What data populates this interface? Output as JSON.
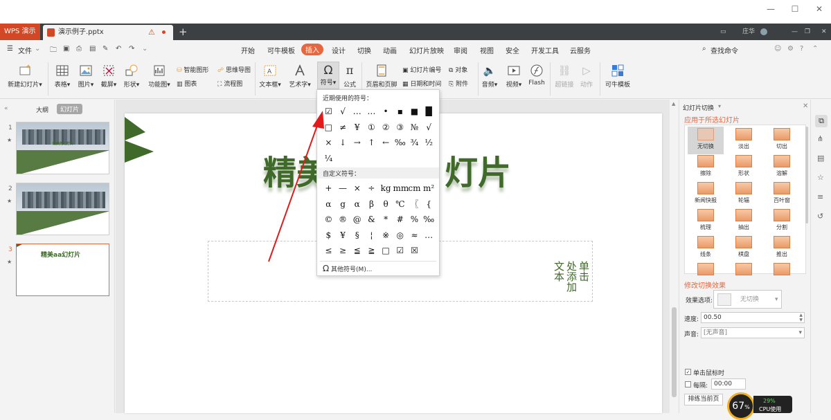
{
  "tabs": {
    "app_label": "WPS 演示",
    "doc_label": "演示例子.pptx",
    "add_label": "+",
    "user_name": "庄华"
  },
  "menu": {
    "file": "文件",
    "items": [
      "开始",
      "可牛模板",
      "插入",
      "设计",
      "切换",
      "动画",
      "幻灯片放映",
      "审阅",
      "视图",
      "安全",
      "开发工具",
      "云服务"
    ],
    "search": "查找命令"
  },
  "ribbon": {
    "new_slide": "新建幻灯片",
    "table": "表格",
    "picture": "图片",
    "screenshot": "截屏",
    "shape": "形状",
    "function_chart": "功能图",
    "smart_shape": "智能图形",
    "chart": "图表",
    "mind_map": "思维导图",
    "flowchart": "流程图",
    "textbox": "文本框",
    "art_text": "艺术字",
    "symbol": "符号",
    "formula": "公式",
    "header_footer": "页眉和页脚",
    "slide_number": "幻灯片编号",
    "object": "对象",
    "date_time": "日期和时间",
    "attachment": "附件",
    "audio": "音频",
    "video": "视频",
    "flash": "Flash",
    "hyperlink": "超链接",
    "action": "动作",
    "kaniu_template": "可牛模板"
  },
  "leftpanel": {
    "outline_tab": "大纲",
    "slides_tab": "幻灯片",
    "thumbs": [
      {
        "num": "1",
        "caption": "精美的幻灯片"
      },
      {
        "num": "2",
        "caption": ""
      },
      {
        "num": "3",
        "caption": "精美aa幻灯片"
      }
    ]
  },
  "slide": {
    "title_visible_left": "精美",
    "title_visible_right": "灯片",
    "vertical_text_cols": [
      "单击",
      "处添加",
      "文本"
    ]
  },
  "symbols": {
    "recent_label": "近期使用的符号：",
    "recent": [
      [
        "☑",
        "√",
        "…",
        "…",
        "•",
        "▪",
        "■",
        "█"
      ],
      [
        "□",
        "≠",
        "¥",
        "①",
        "②",
        "③",
        "№",
        "√"
      ],
      [
        "×",
        "↓",
        "→",
        "↑",
        "←",
        "‰",
        "¾",
        "½"
      ],
      [
        "¼"
      ]
    ],
    "custom_label": "自定义符号：",
    "custom": [
      [
        "+",
        "—",
        "×",
        "÷",
        "kg",
        "mm",
        "cm",
        "m²"
      ],
      [
        "α",
        "g",
        "α",
        "β",
        "θ",
        "℃",
        "〖",
        "{"
      ],
      [
        "©",
        "®",
        "@",
        "&",
        "*",
        "#",
        "%",
        "‰"
      ],
      [
        "$",
        "¥",
        "§",
        "¦",
        "※",
        "◎",
        "≈",
        "…"
      ],
      [
        "≤",
        "≥",
        "≦",
        "≧",
        "□",
        "☑",
        "☒"
      ]
    ],
    "more": "其他符号(M)..."
  },
  "rightpanel": {
    "title": "幻灯片切换",
    "apply_label": "应用于所选幻灯片",
    "transitions": [
      "无切换",
      "淡出",
      "切出",
      "擦除",
      "形状",
      "溶解",
      "新闻快报",
      "轮辐",
      "百叶窗",
      "梳理",
      "抽出",
      "分割",
      "线条",
      "棋盘",
      "推出",
      "",
      "",
      ""
    ],
    "modify_label": "修改切换效果",
    "effect_label": "效果选项:",
    "effect_value": "无切换",
    "speed_label": "速度:",
    "speed_value": "00.50",
    "sound_label": "声音:",
    "sound_value": "[无声音]",
    "on_click_label": "单击鼠标时",
    "every_label": "每隔:",
    "every_value": "00:00",
    "apply_current": "排练当前页"
  },
  "cpu": {
    "percent": "67",
    "percent_unit": "%",
    "usage": "29%",
    "usage_label": "CPU使用"
  },
  "colors": {
    "accent": "#e8663d",
    "wps_red": "#d24726",
    "slide_green": "#3f6a2a",
    "annotation_red": "#e11b1b"
  }
}
